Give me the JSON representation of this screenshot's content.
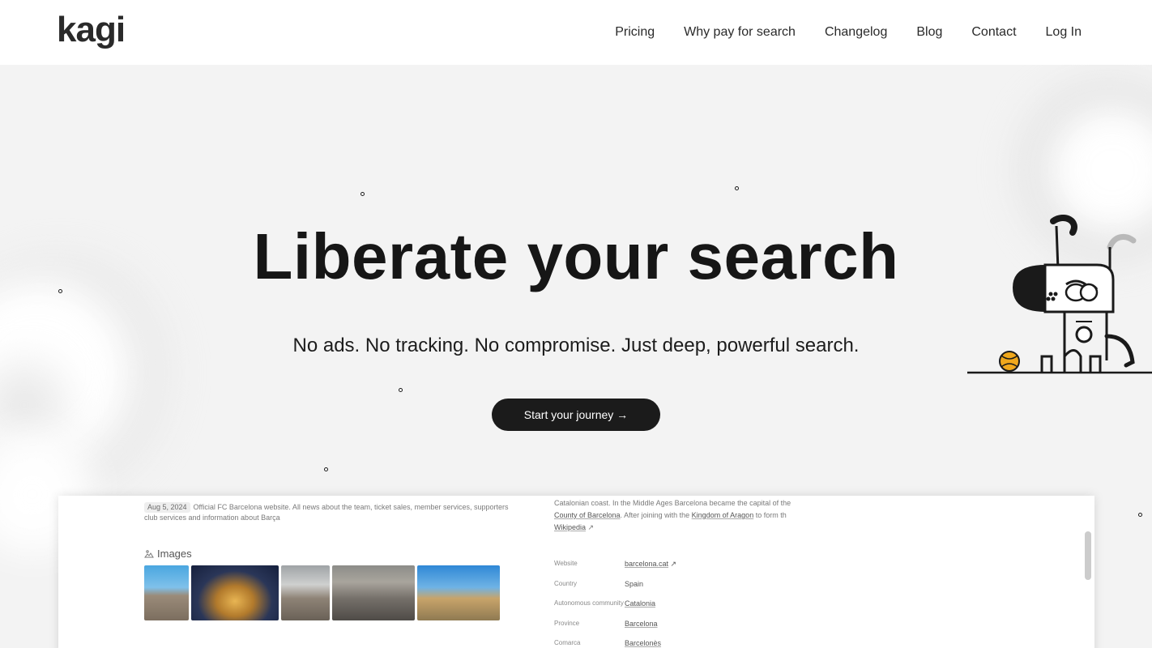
{
  "header": {
    "logo_text": "kagi",
    "nav": [
      "Pricing",
      "Why pay for search",
      "Changelog",
      "Blog",
      "Contact",
      "Log In"
    ]
  },
  "hero": {
    "title": "Liberate your search",
    "subtitle": "No ads. No tracking. No compromise. Just deep, powerful search.",
    "cta": "Start your journey →"
  },
  "preview": {
    "result_date": "Aug 5, 2024",
    "result_snippet": "Official FC Barcelona website. All news about the team, ticket sales, member services, supporters club services and information about Barça",
    "images_label": "Images",
    "knowledge_text_1": "Catalonian coast. In the Middle Ages Barcelona became the capital of the",
    "knowledge_link_1": "County of Barcelona",
    "knowledge_text_2": ". After joining with the",
    "knowledge_link_2": "Kingdom of Aragon",
    "knowledge_text_3": "to form th",
    "knowledge_link_3": "Wikipedia",
    "facts": [
      {
        "key": "Website",
        "value": "barcelona.cat"
      },
      {
        "key": "Country",
        "value": "Spain"
      },
      {
        "key": "Autonomous community",
        "value": "Catalonia"
      },
      {
        "key": "Province",
        "value": "Barcelona"
      },
      {
        "key": "Comarca",
        "value": "Barcelonès"
      }
    ]
  },
  "colors": {
    "background": "#f3f3f3",
    "header_bg": "#ffffff",
    "cta_bg": "#1b1b1b",
    "text": "#1a1a1a",
    "ball": "#f0a81c"
  }
}
